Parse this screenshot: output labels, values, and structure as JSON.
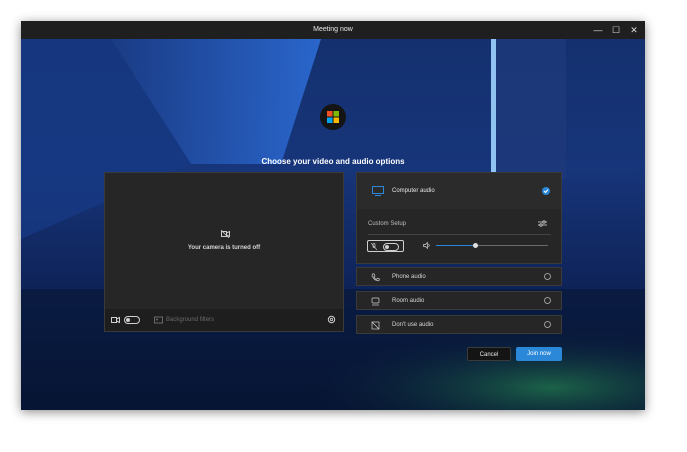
{
  "window": {
    "title": "Meeting now"
  },
  "window_controls": {
    "minimize": "—",
    "maximize": "☐",
    "close": "✕"
  },
  "main": {
    "heading": "Choose your video and audio options"
  },
  "video": {
    "camera_off_message": "Your camera is turned off",
    "background_filters_label": "Background filters"
  },
  "audio": {
    "computer_audio_label": "Computer audio",
    "custom_setup_label": "Custom Setup",
    "volume_level": 0.35,
    "options": [
      {
        "label": "Phone audio",
        "icon": "phone-icon"
      },
      {
        "label": "Room audio",
        "icon": "room-audio-icon"
      },
      {
        "label": "Don't use audio",
        "icon": "no-audio-icon"
      }
    ]
  },
  "actions": {
    "cancel_label": "Cancel",
    "join_label": "Join now"
  },
  "colors": {
    "accent": "#2b88d8",
    "card": "#262626",
    "titlebar": "#1f1f1f"
  }
}
